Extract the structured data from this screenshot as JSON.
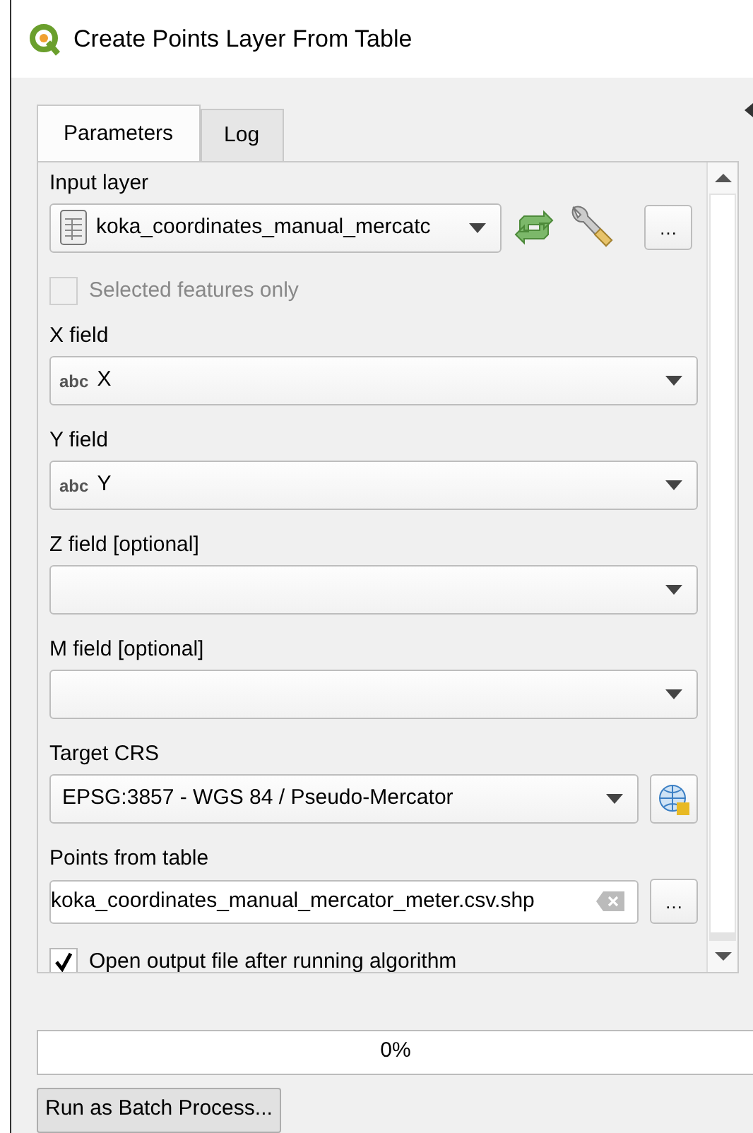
{
  "window": {
    "title": "Create Points Layer From Table"
  },
  "tabs": [
    {
      "label": "Parameters",
      "selected": true
    },
    {
      "label": "Log",
      "selected": false
    }
  ],
  "params": [
    {
      "kind": "layer",
      "label": "Input layer",
      "value": "koka_coordinates_manual_mercatc",
      "button": "…"
    },
    {
      "kind": "checkbox",
      "label": "Selected features only",
      "checked": false,
      "disabled": true
    },
    {
      "kind": "combo",
      "label": "X field",
      "tag": "abc",
      "value": "X"
    },
    {
      "kind": "combo",
      "label": "Y field",
      "tag": "abc",
      "value": "Y"
    },
    {
      "kind": "combo",
      "label": "Z field [optional]"
    },
    {
      "kind": "combo",
      "label": "M field [optional]"
    },
    {
      "kind": "crs",
      "label": "Target CRS",
      "value": "EPSG:3857 - WGS 84 / Pseudo-Mercator"
    },
    {
      "kind": "output",
      "label": "Points from table",
      "value": "koka_coordinates_manual_mercator_meter.csv.shp",
      "button": "…"
    },
    {
      "kind": "checkbox",
      "label": "Open output file after running algorithm",
      "checked": true,
      "disabled": false
    }
  ],
  "progress": {
    "level": 0,
    "reading": "0%"
  },
  "batch_button": "Run as Batch Process..."
}
